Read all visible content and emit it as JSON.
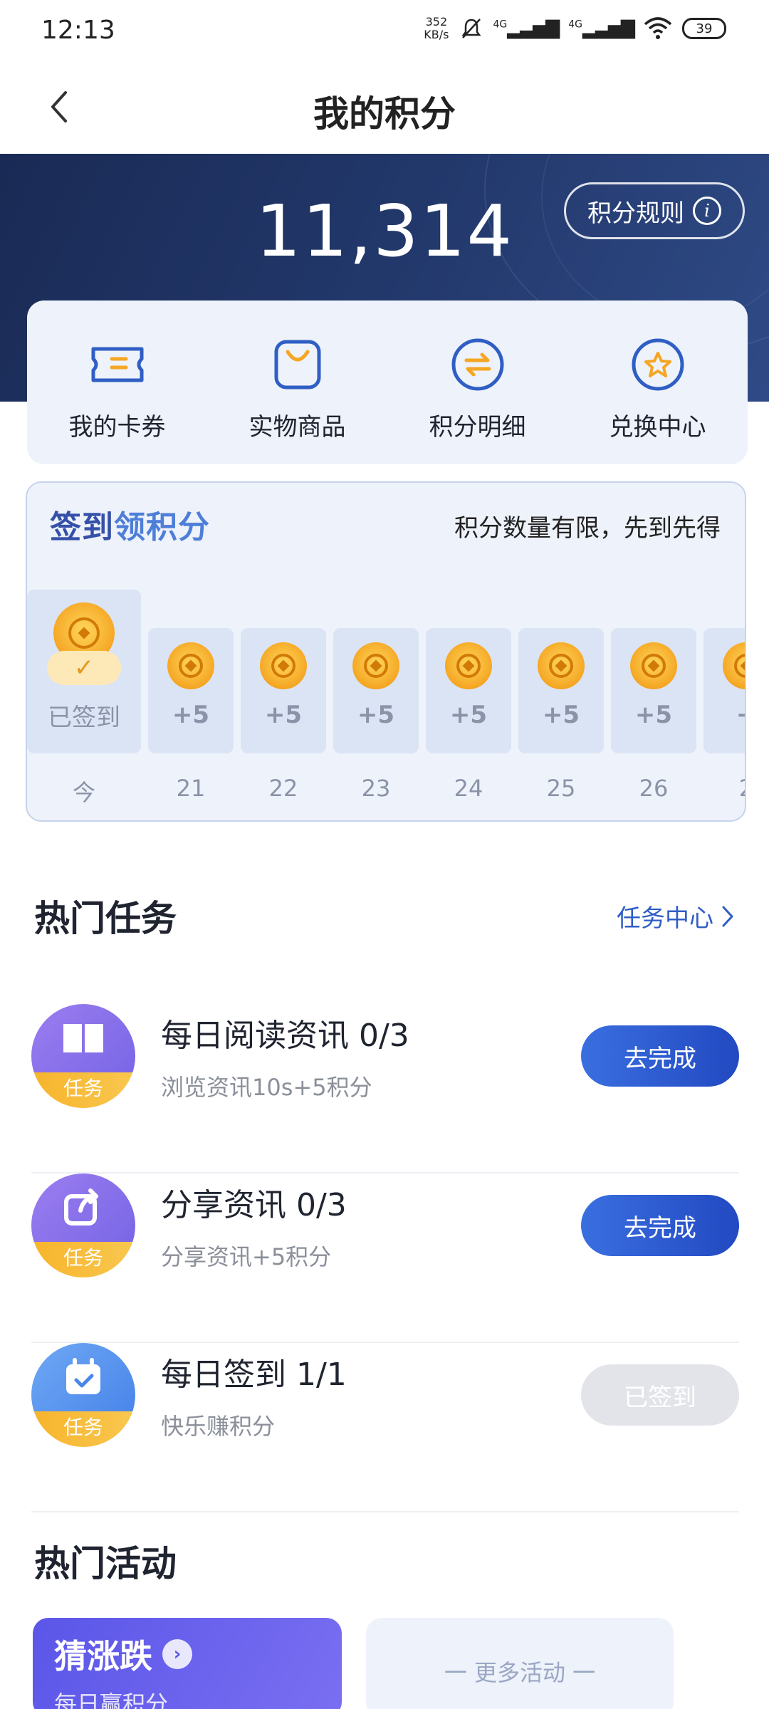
{
  "status": {
    "time": "12:13",
    "netspeed_top": "352",
    "netspeed_bottom": "KB/s",
    "sig1": "4G",
    "sig2": "4G",
    "battery": "39"
  },
  "header": {
    "title": "我的积分"
  },
  "hero": {
    "points": "11,314",
    "rules_label": "积分规则"
  },
  "quick_entries": [
    {
      "label": "我的卡券",
      "icon": "ticket-icon"
    },
    {
      "label": "实物商品",
      "icon": "shopping-bag-icon"
    },
    {
      "label": "积分明细",
      "icon": "exchange-icon"
    },
    {
      "label": "兑换中心",
      "icon": "star-icon"
    }
  ],
  "signin": {
    "title_part1": "签到",
    "title_part2": "领积分",
    "note": "积分数量有限，先到先得",
    "today_status": "已签到",
    "today_label": "今",
    "days": [
      {
        "label": "21",
        "reward": "+5"
      },
      {
        "label": "22",
        "reward": "+5"
      },
      {
        "label": "23",
        "reward": "+5"
      },
      {
        "label": "24",
        "reward": "+5"
      },
      {
        "label": "25",
        "reward": "+5"
      },
      {
        "label": "26",
        "reward": "+5"
      },
      {
        "label": "2",
        "reward": "+"
      }
    ]
  },
  "tasks": {
    "section_title": "热门任务",
    "center_link": "任务中心",
    "items": [
      {
        "title": "每日阅读资讯 0/3",
        "desc": "浏览资讯10s+5积分",
        "badge": "任务",
        "button": "去完成",
        "state": "go"
      },
      {
        "title": "分享资讯 0/3",
        "desc": "分享资讯+5积分",
        "badge": "任务",
        "button": "去完成",
        "state": "go"
      },
      {
        "title": "每日签到 1/1",
        "desc": "快乐赚积分",
        "badge": "任务",
        "button": "已签到",
        "state": "done"
      }
    ]
  },
  "activities": {
    "section_title": "热门活动",
    "main_title": "猜涨跌",
    "main_sub": "每日赢积分",
    "more": "一 更多活动 一"
  },
  "colors": {
    "hero_bg": "#22386b",
    "accent_blue": "#2f5ec4",
    "coin_gold": "#f5a623"
  }
}
